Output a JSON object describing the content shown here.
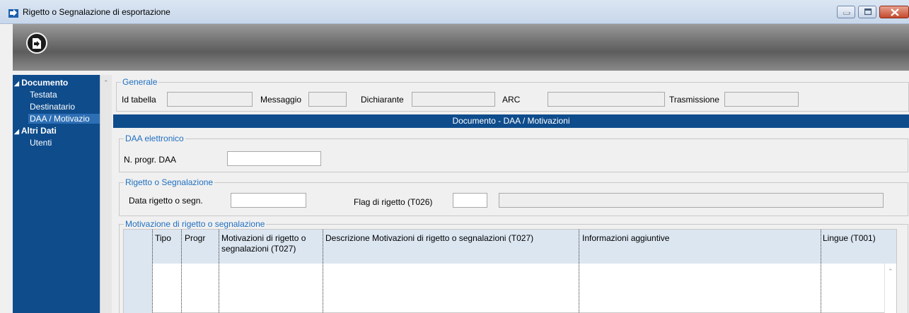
{
  "window": {
    "title": "Rigetto o Segnalazione di esportazione"
  },
  "sidebar": {
    "items": [
      {
        "label": "Documento",
        "type": "group"
      },
      {
        "label": "Testata",
        "type": "child"
      },
      {
        "label": "Destinatario",
        "type": "child"
      },
      {
        "label": "DAA / Motivazio",
        "type": "child",
        "selected": true
      },
      {
        "label": "Altri Dati",
        "type": "group"
      },
      {
        "label": "Utenti",
        "type": "child"
      }
    ]
  },
  "generale": {
    "legend": "Generale",
    "id_tabella_label": "Id tabella",
    "id_tabella_value": "",
    "messaggio_label": "Messaggio",
    "messaggio_value": "",
    "dichiarante_label": "Dichiarante",
    "dichiarante_value": "",
    "arc_label": "ARC",
    "arc_value": "",
    "trasmissione_label": "Trasmissione",
    "trasmissione_value": ""
  },
  "section_band": "Documento - DAA / Motivazioni",
  "daa": {
    "legend": "DAA elettronico",
    "n_progr_label": "N. progr. DAA",
    "n_progr_value": ""
  },
  "rigetto": {
    "legend": "Rigetto o Segnalazione",
    "data_label": "Data rigetto o segn.",
    "data_value": "",
    "flag_label": "Flag di rigetto (T026)",
    "flag_value": "",
    "flag_desc": ""
  },
  "motivazione": {
    "legend": "Motivazione di rigetto o segnalazione",
    "columns": [
      "Tipo",
      "Progr",
      "Motivazioni di rigetto o segnalazioni (T027)",
      "Descrizione Motivazioni di rigetto o segnalazioni (T027)",
      "Informazioni aggiuntive",
      "Lingue (T001)"
    ]
  },
  "colors": {
    "accent_blue": "#0e4c8c",
    "legend_blue": "#1f6fc0",
    "grid_header": "#dce6f1"
  }
}
